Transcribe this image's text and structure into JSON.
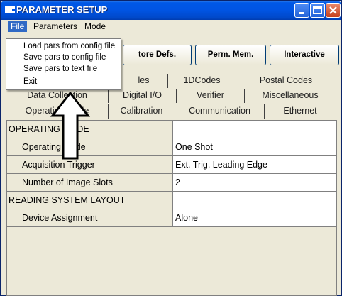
{
  "window": {
    "title": "PARAMETER SETUP"
  },
  "menubar": {
    "file": "File",
    "parameters": "Parameters",
    "mode": "Mode"
  },
  "file_menu": {
    "items": [
      "Load pars from config file",
      "Save pars to config file",
      "Save pars to text file",
      "Exit"
    ]
  },
  "toolbar": {
    "restore_label": "tore Defs.",
    "perm_label": "Perm. Mem.",
    "interactive_label": "Interactive"
  },
  "tabs": {
    "row1": [
      "les",
      "1DCodes",
      "Postal Codes"
    ],
    "row2": [
      "Data Collection",
      "Digital I/O",
      "Verifier",
      "Miscellaneous"
    ],
    "row3": [
      "Operating Mode",
      "Calibration",
      "Communication",
      "Ethernet"
    ]
  },
  "grid": {
    "rows": [
      {
        "kind": "header",
        "label": "OPERATING MODE",
        "value": ""
      },
      {
        "kind": "item",
        "label": "Operating Mode",
        "value": "One Shot"
      },
      {
        "kind": "item",
        "label": "Acquisition Trigger",
        "value": "Ext. Trig. Leading Edge"
      },
      {
        "kind": "item",
        "label": "Number of Image Slots",
        "value": "2"
      },
      {
        "kind": "header",
        "label": "READING SYSTEM LAYOUT",
        "value": ""
      },
      {
        "kind": "item",
        "label": "Device Assignment",
        "value": "Alone"
      }
    ]
  },
  "colors": {
    "titlebar": "#0054e3",
    "menu_highlight": "#316ac5",
    "close_button": "#c8401c"
  },
  "icons": {
    "app": "app-logo-icon",
    "minimize": "minimize-icon",
    "maximize": "maximize-icon",
    "close": "close-icon",
    "pointer": "up-arrow-annotation"
  }
}
